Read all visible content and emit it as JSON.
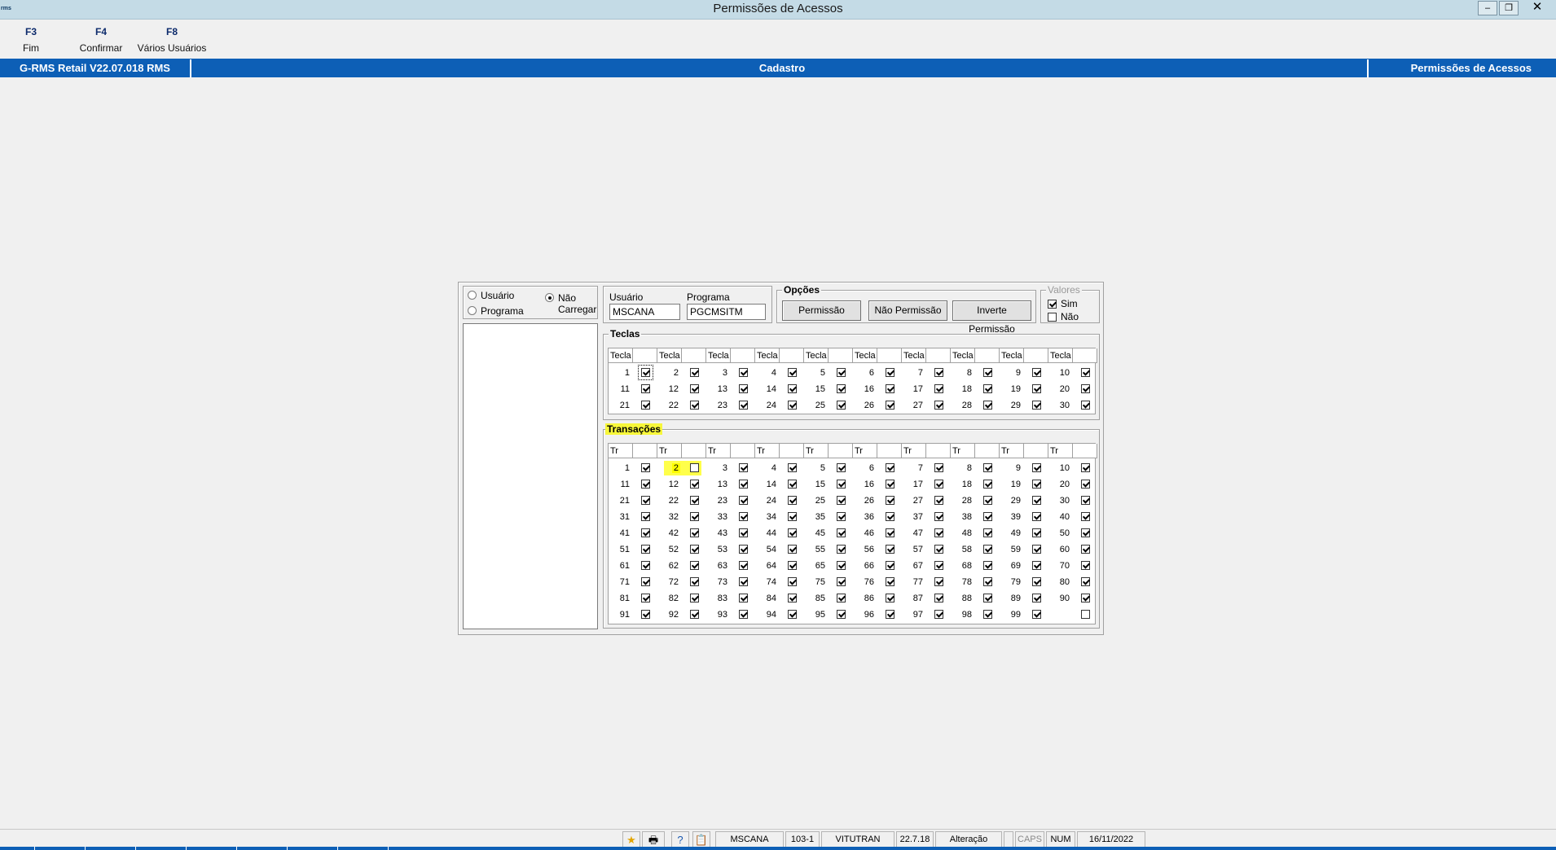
{
  "window": {
    "title": "Permissões de Acessos",
    "icon_text": "rms"
  },
  "toolbar": {
    "keys": [
      {
        "key": "F3",
        "label": "Fim"
      },
      {
        "key": "F4",
        "label": "Confirmar"
      },
      {
        "key": "F8",
        "label": "Vários Usuários"
      }
    ]
  },
  "banner": {
    "left": "G-RMS Retail V22.07.018 RMS",
    "center": "Cadastro",
    "right": "Permissões de Acessos"
  },
  "filter": {
    "usuario": "Usuário",
    "programa": "Programa",
    "nao_carregar": "Não\nCarregar",
    "selected": "nao_carregar"
  },
  "fields": {
    "usuario_label": "Usuário",
    "usuario_value": "MSCANA",
    "programa_label": "Programa",
    "programa_value": "PGCMSITM"
  },
  "opcoes": {
    "title": "Opções",
    "buttons": [
      "Permissão",
      "Não Permissão",
      "Inverte Permissão"
    ]
  },
  "valores": {
    "title": "Valores",
    "sim": "Sim",
    "nao": "Não",
    "sim_checked": true,
    "nao_checked": false
  },
  "teclas": {
    "title": "Teclas",
    "header": "Tecla",
    "rows": [
      [
        1,
        2,
        3,
        4,
        5,
        6,
        7,
        8,
        9,
        10
      ],
      [
        11,
        12,
        13,
        14,
        15,
        16,
        17,
        18,
        19,
        20
      ],
      [
        21,
        22,
        23,
        24,
        25,
        26,
        27,
        28,
        29,
        30
      ]
    ]
  },
  "transacoes": {
    "title": "Transações",
    "header": "Tr",
    "rows": [
      [
        1,
        2,
        3,
        4,
        5,
        6,
        7,
        8,
        9,
        10
      ],
      [
        11,
        12,
        13,
        14,
        15,
        16,
        17,
        18,
        19,
        20
      ],
      [
        21,
        22,
        23,
        24,
        25,
        26,
        27,
        28,
        29,
        30
      ],
      [
        31,
        32,
        33,
        34,
        35,
        36,
        37,
        38,
        39,
        40
      ],
      [
        41,
        42,
        43,
        44,
        45,
        46,
        47,
        48,
        49,
        50
      ],
      [
        51,
        52,
        53,
        54,
        55,
        56,
        57,
        58,
        59,
        60
      ],
      [
        61,
        62,
        63,
        64,
        65,
        66,
        67,
        68,
        69,
        70
      ],
      [
        71,
        72,
        73,
        74,
        75,
        76,
        77,
        78,
        79,
        80
      ],
      [
        81,
        82,
        83,
        84,
        85,
        86,
        87,
        88,
        89,
        90
      ],
      [
        91,
        92,
        93,
        94,
        95,
        96,
        97,
        98,
        99,
        null
      ]
    ],
    "unchecked": [
      2,
      null
    ],
    "highlighted": 2
  },
  "statusbar": {
    "user": "MSCANA",
    "code": "103-1",
    "company": "VITUTRAN",
    "version": "22.7.18",
    "mode": "Alteração",
    "caps": "CAPS",
    "num": "NUM",
    "date": "16/11/2022"
  }
}
